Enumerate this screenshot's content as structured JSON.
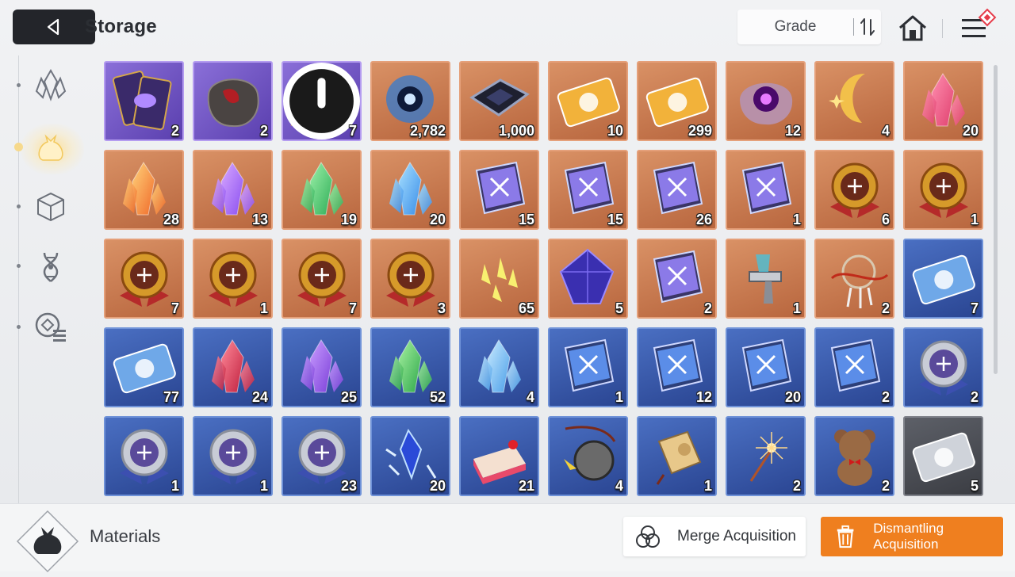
{
  "header": {
    "title": "Storage",
    "sort_label": "Grade"
  },
  "sidebar": {
    "items": [
      {
        "name": "crystal-icon",
        "active": false
      },
      {
        "name": "pouch-icon",
        "active": true
      },
      {
        "name": "cube-icon",
        "active": false
      },
      {
        "name": "helix-icon",
        "active": false
      },
      {
        "name": "gear-list-icon",
        "active": false
      }
    ]
  },
  "footer": {
    "category_label": "Materials",
    "merge_label": "Merge Acquisition",
    "dismantle_label": "Dismantling Acquisition"
  },
  "colors": {
    "accent_orange": "#ef7f1f",
    "grade_purple": "#6b4fc0",
    "grade_orange": "#c47548",
    "grade_blue": "#3556a6",
    "grade_gray": "#4a4c52"
  },
  "items": [
    {
      "icon": "eye-cards-icon",
      "grade": "purple",
      "count": "2"
    },
    {
      "icon": "dark-rock-icon",
      "grade": "purple",
      "count": "2"
    },
    {
      "icon": "triangle-emblem-icon",
      "grade": "purple",
      "count": "7",
      "badge": true
    },
    {
      "icon": "blue-orb-eye-icon",
      "grade": "orange",
      "count": "2,782"
    },
    {
      "icon": "chip-icon",
      "grade": "orange",
      "count": "1,000"
    },
    {
      "icon": "gold-ticket-portrait-icon",
      "grade": "orange",
      "count": "10"
    },
    {
      "icon": "gold-ticket-star-icon",
      "grade": "orange",
      "count": "299"
    },
    {
      "icon": "purple-eye-rock-icon",
      "grade": "orange",
      "count": "12"
    },
    {
      "icon": "gold-moon-icon",
      "grade": "orange",
      "count": "4"
    },
    {
      "icon": "pink-crystal-icon",
      "grade": "orange",
      "count": "20"
    },
    {
      "icon": "orange-crystal-icon",
      "grade": "orange",
      "count": "28"
    },
    {
      "icon": "purple-crystal-icon",
      "grade": "orange",
      "count": "13"
    },
    {
      "icon": "green-crystal-icon",
      "grade": "orange",
      "count": "19"
    },
    {
      "icon": "blue-crystal-icon",
      "grade": "orange",
      "count": "20"
    },
    {
      "icon": "book-sword-icon",
      "grade": "orange",
      "count": "15"
    },
    {
      "icon": "book-shield-icon",
      "grade": "orange",
      "count": "15"
    },
    {
      "icon": "book-wing-icon",
      "grade": "orange",
      "count": "26"
    },
    {
      "icon": "book-bolt-icon",
      "grade": "orange",
      "count": "1"
    },
    {
      "icon": "medal-sword-icon",
      "grade": "orange",
      "count": "6"
    },
    {
      "icon": "medal-shield-icon",
      "grade": "orange",
      "count": "1"
    },
    {
      "icon": "medal-square-icon",
      "grade": "orange",
      "count": "7"
    },
    {
      "icon": "medal-wing-icon",
      "grade": "orange",
      "count": "1"
    },
    {
      "icon": "medal-bolt-icon",
      "grade": "orange",
      "count": "7"
    },
    {
      "icon": "medal-target-icon",
      "grade": "orange",
      "count": "3"
    },
    {
      "icon": "yellow-shards-icon",
      "grade": "orange",
      "count": "65"
    },
    {
      "icon": "dark-gem-icon",
      "grade": "orange",
      "count": "5"
    },
    {
      "icon": "old-book-icon",
      "grade": "orange",
      "count": "2"
    },
    {
      "icon": "spray-gun-icon",
      "grade": "orange",
      "count": "1"
    },
    {
      "icon": "dreamcatcher-icon",
      "grade": "orange",
      "count": "2"
    },
    {
      "icon": "blue-ticket-portrait-icon",
      "grade": "blue",
      "count": "7"
    },
    {
      "icon": "blue-ticket-star-icon",
      "grade": "blue",
      "count": "77"
    },
    {
      "icon": "red-crystal-icon",
      "grade": "blue",
      "count": "24"
    },
    {
      "icon": "violet-crystal-icon",
      "grade": "blue",
      "count": "25"
    },
    {
      "icon": "emerald-crystal-icon",
      "grade": "blue",
      "count": "52"
    },
    {
      "icon": "ice-crystal-icon",
      "grade": "blue",
      "count": "4"
    },
    {
      "icon": "blue-book-sword-icon",
      "grade": "blue",
      "count": "1"
    },
    {
      "icon": "blue-book-shield-icon",
      "grade": "blue",
      "count": "12"
    },
    {
      "icon": "blue-book-target-icon",
      "grade": "blue",
      "count": "20"
    },
    {
      "icon": "blue-book-wing-icon",
      "grade": "blue",
      "count": "2"
    },
    {
      "icon": "silver-medal-sword-icon",
      "grade": "blue",
      "count": "2"
    },
    {
      "icon": "silver-medal-shield-icon",
      "grade": "blue",
      "count": "1"
    },
    {
      "icon": "silver-medal-wing-icon",
      "grade": "blue",
      "count": "1"
    },
    {
      "icon": "silver-medal-bolt-icon",
      "grade": "blue",
      "count": "23"
    },
    {
      "icon": "ice-shard-icon",
      "grade": "blue",
      "count": "20"
    },
    {
      "icon": "cake-icon",
      "grade": "blue",
      "count": "21"
    },
    {
      "icon": "pocket-watch-icon",
      "grade": "blue",
      "count": "4"
    },
    {
      "icon": "gold-tag-icon",
      "grade": "blue",
      "count": "1"
    },
    {
      "icon": "sparkler-icon",
      "grade": "blue",
      "count": "2"
    },
    {
      "icon": "teddy-bear-icon",
      "grade": "blue",
      "count": "2"
    },
    {
      "icon": "gray-ticket-icon",
      "grade": "gray",
      "count": "5"
    }
  ]
}
